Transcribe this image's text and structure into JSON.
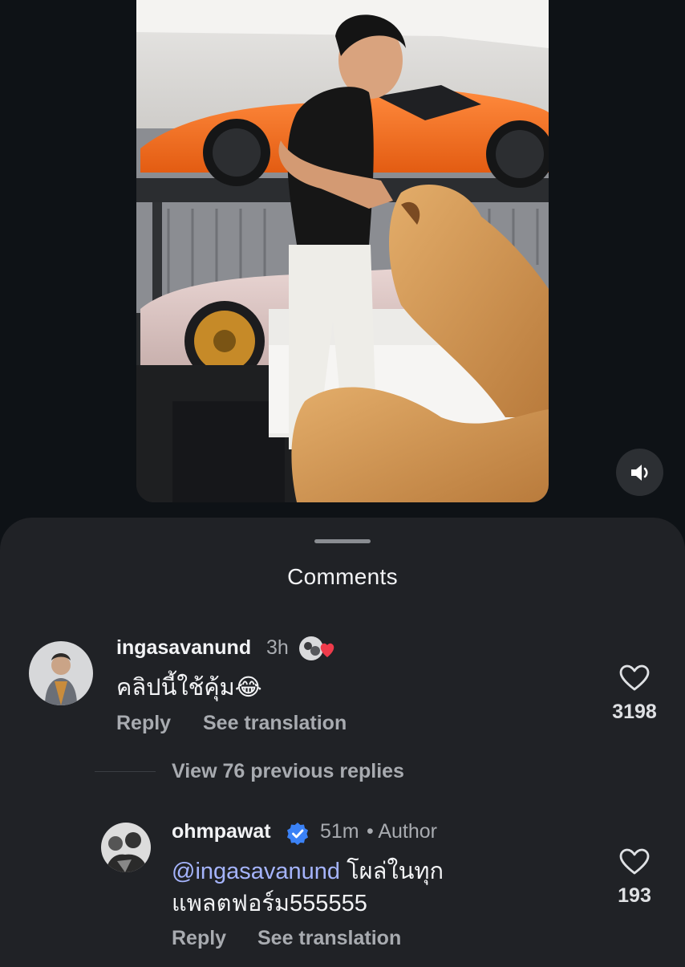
{
  "video": {
    "icons": {
      "mute": "speaker-icon"
    }
  },
  "sheet": {
    "title": "Comments"
  },
  "comments": [
    {
      "username": "ingasavanund",
      "time": "3h",
      "text_emoji": "😂",
      "text": "คลิปนี้ใช้คุ้ม",
      "reply_label": "Reply",
      "translate_label": "See translation",
      "likes": "3198",
      "creator_liked": true,
      "icons": {
        "like": "heart-outline-icon",
        "creator_like": "red-heart-icon"
      }
    },
    {
      "view_replies": "View 76 previous replies"
    },
    {
      "username": "ohmpawat",
      "time": "51m",
      "author_tag": "• Author",
      "mention": "@ingasavanund",
      "text_line1": "โผล่ในทุก",
      "text_line2": "แพลตฟอร์ม555555",
      "reply_label": "Reply",
      "translate_label": "See translation",
      "likes": "193",
      "verified": true,
      "icons": {
        "verified": "verified-badge-icon",
        "like": "heart-outline-icon"
      }
    }
  ],
  "colors": {
    "background": "#0e1216",
    "sheet": "#202226",
    "mention": "#a5b4fc",
    "verified": "#3b82f6",
    "creator_heart": "#ef3b4b"
  }
}
